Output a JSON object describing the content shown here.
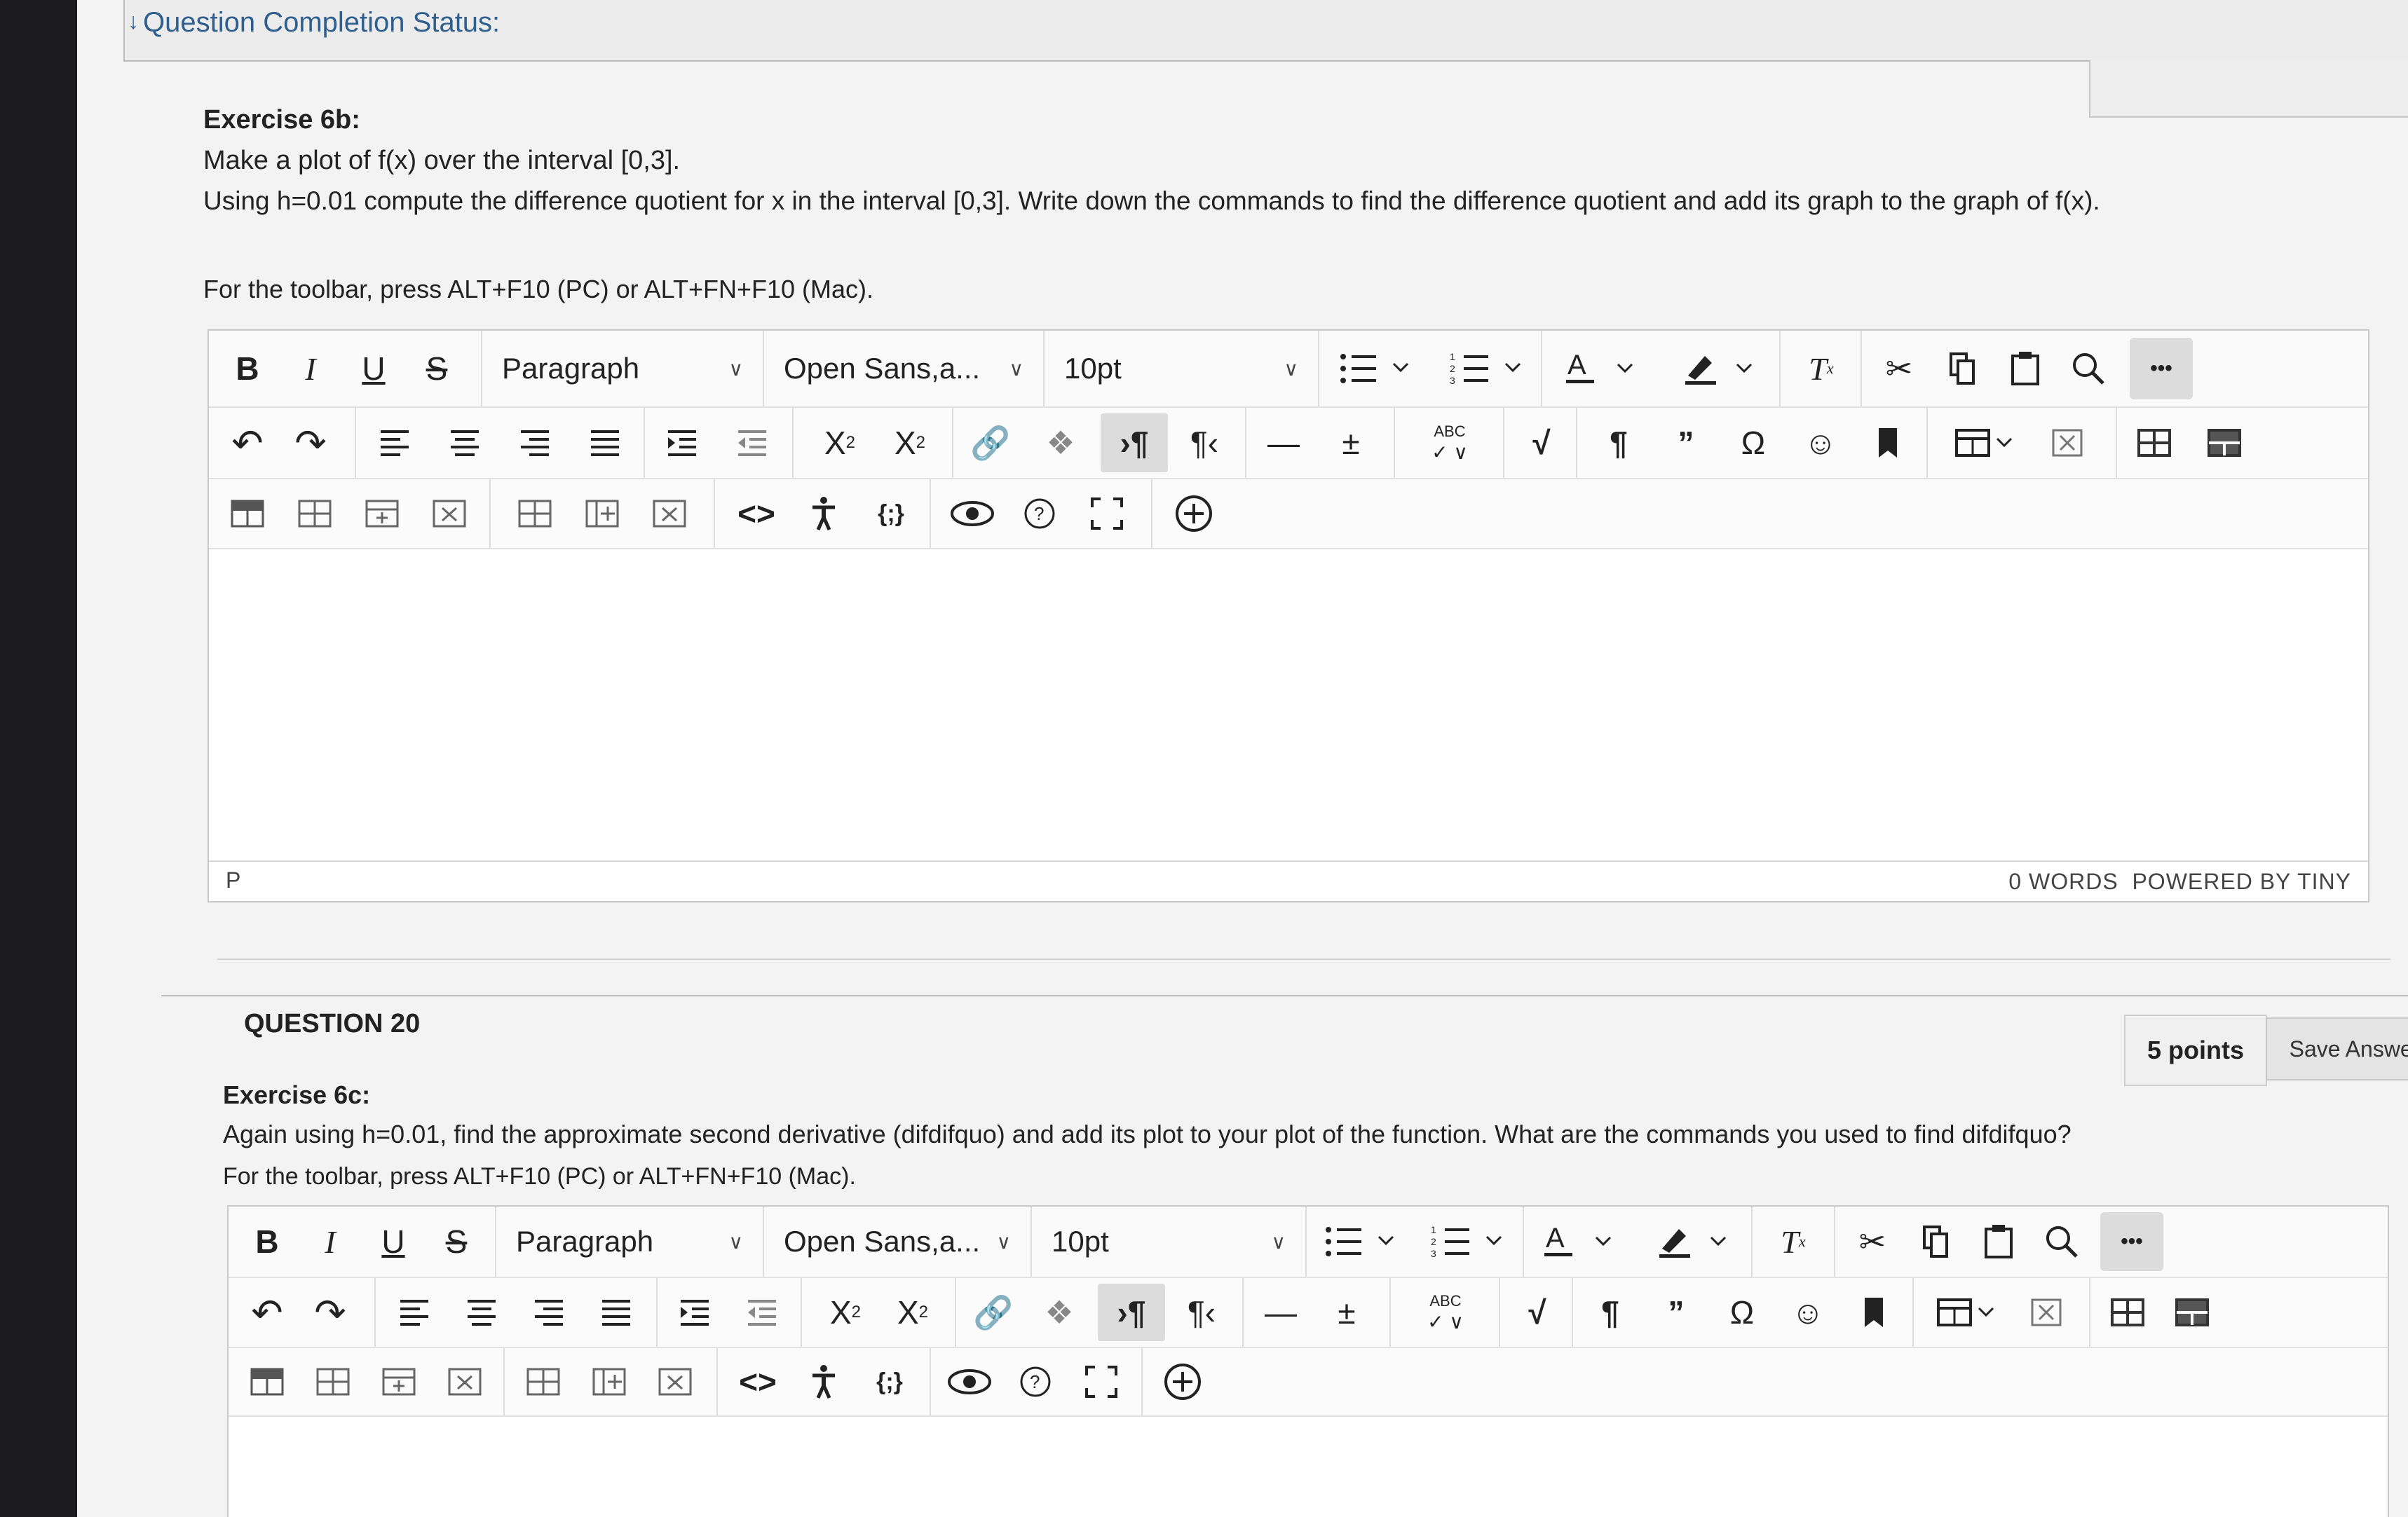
{
  "status": {
    "label": "Question Completion Status:"
  },
  "q19": {
    "title": "Exercise 6b:",
    "line1": "Make a plot of f(x) over the interval [0,3].",
    "line2": "Using h=0.01 compute the difference quotient for x in the interval [0,3]. Write down the commands to find the difference quotient and add its graph to the graph of f(x).",
    "toolbar_hint": "For the toolbar, press ALT+F10 (PC) or ALT+FN+F10 (Mac)."
  },
  "editor": {
    "bold": "B",
    "italic": "I",
    "underline": "U",
    "strike": "S",
    "block_format": "Paragraph",
    "font_family": "Open Sans,a...",
    "font_size": "10pt",
    "more": "•••",
    "path": "P",
    "word_count": "0 WORDS",
    "powered": "POWERED BY TINY"
  },
  "q20": {
    "heading": "QUESTION 20",
    "points": "5 points",
    "save": "Save Answer",
    "title": "Exercise 6c:",
    "line1": "Again using h=0.01, find the approximate second derivative (difdifquo) and add its plot to your plot of the function. What are the commands you used to find difdifquo?",
    "toolbar_hint": "For the toolbar, press ALT+F10 (PC) or ALT+FN+F10 (Mac)."
  },
  "editor2": {
    "block_format": "Paragraph",
    "font_family": "Open Sans,a...",
    "font_size": "10pt",
    "more": "•••"
  },
  "icons": [
    "undo-icon",
    "redo-icon",
    "align-left-icon",
    "align-center-icon",
    "align-right-icon",
    "justify-icon",
    "indent-icon",
    "outdent-icon",
    "superscript-icon",
    "subscript-icon",
    "link-icon",
    "unlink-icon",
    "ltr-icon",
    "rtl-icon",
    "hr-icon",
    "insert-icon",
    "spellcheck-icon",
    "math-icon",
    "paragraph-icon",
    "quote-icon",
    "omega-icon",
    "emoji-icon",
    "bookmark-icon",
    "table-icon",
    "delete-table-icon",
    "eye-icon",
    "help-icon",
    "fullscreen-icon",
    "add-icon",
    "accessibility-icon",
    "code-icon",
    "braces-icon"
  ]
}
